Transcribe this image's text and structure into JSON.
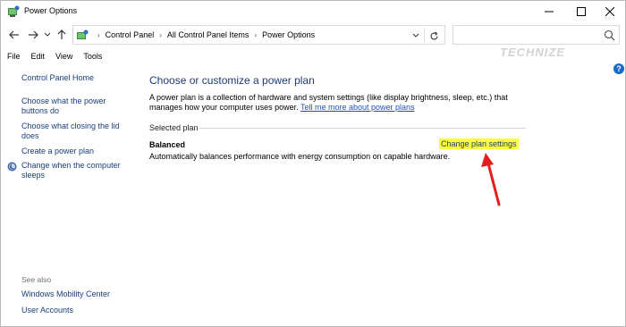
{
  "window": {
    "title": "Power Options"
  },
  "address": {
    "crumbs": [
      "Control Panel",
      "All Control Panel Items",
      "Power Options"
    ]
  },
  "search": {
    "placeholder": "",
    "watermark": "TECHNIZE"
  },
  "menu": [
    "File",
    "Edit",
    "View",
    "Tools"
  ],
  "sidebar": {
    "home": "Control Panel Home",
    "items": [
      "Choose what the power buttons do",
      "Choose what closing the lid does",
      "Create a power plan",
      "Change when the computer sleeps"
    ],
    "see_also_title": "See also",
    "see_also": [
      "Windows Mobility Center",
      "User Accounts"
    ]
  },
  "main": {
    "heading": "Choose or customize a power plan",
    "description": "A power plan is a collection of hardware and system settings (like display brightness, sleep, etc.) that manages how your computer uses power.",
    "learn_more": "Tell me more about power plans",
    "selected_plan_label": "Selected plan",
    "plan_name": "Balanced",
    "plan_description": "Automatically balances performance with energy consumption on capable hardware.",
    "change_link": "Change plan settings"
  },
  "colors": {
    "link": "#1a3e7a",
    "highlight": "#ffff3a",
    "arrow": "#e31e1e",
    "heading": "#1e3a78"
  }
}
